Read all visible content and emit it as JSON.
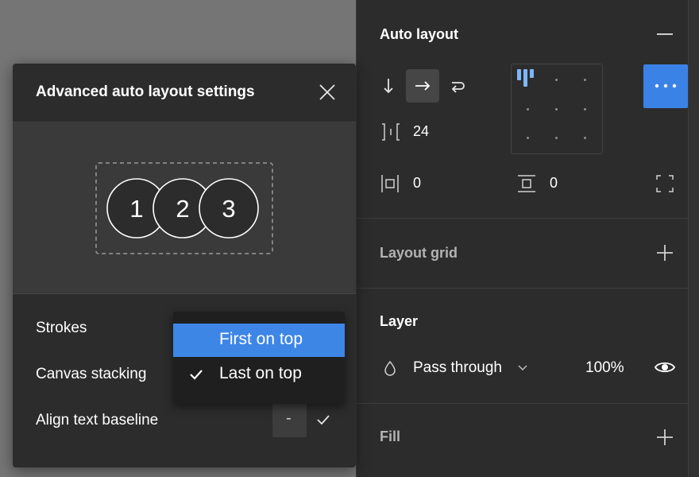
{
  "modal": {
    "title": "Advanced auto layout settings",
    "preview_items": [
      "1",
      "2",
      "3"
    ],
    "rows": {
      "strokes": "Strokes",
      "canvas_stacking": "Canvas stacking",
      "align_text_baseline": "Align text baseline"
    },
    "dropdown": {
      "options": [
        {
          "label": "First on top",
          "highlighted": true,
          "checked": false
        },
        {
          "label": "Last on top",
          "highlighted": false,
          "checked": true
        }
      ]
    },
    "baseline_toggle": {
      "off_symbol": "-",
      "on_checked": true
    }
  },
  "panel": {
    "auto_layout": {
      "title": "Auto layout",
      "spacing": "24",
      "horizontal_padding": "0",
      "vertical_padding": "0",
      "active_direction": "horizontal"
    },
    "layout_grid": {
      "title": "Layout grid"
    },
    "layer": {
      "title": "Layer",
      "blend_mode": "Pass through",
      "opacity": "100%"
    },
    "fill": {
      "title": "Fill"
    }
  },
  "colors": {
    "accent": "#3d86e6",
    "panel_bg": "#2c2c2c",
    "canvas_bg": "#757575",
    "alignment_bars": "#7fb6f5"
  }
}
